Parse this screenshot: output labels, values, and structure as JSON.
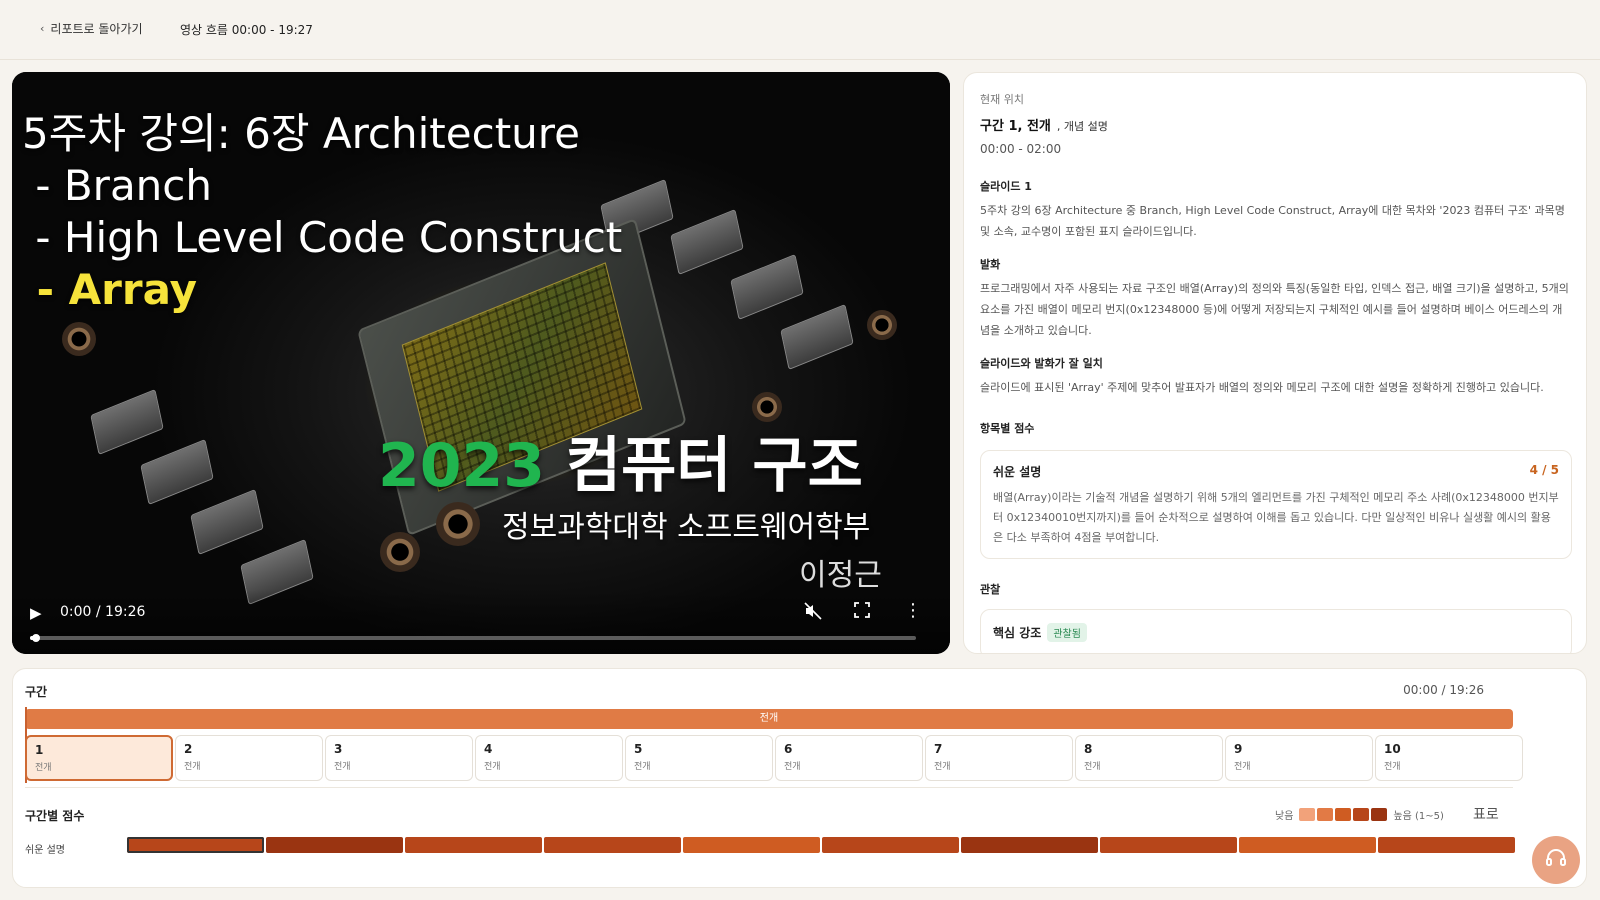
{
  "header": {
    "back_label": "리포트로 돌아가기",
    "flow_label": "영상 흐름 00:00 - 19:27"
  },
  "video": {
    "slide": {
      "title_line1": "5주차 강의: 6장 Architecture",
      "title_line2": " - Branch",
      "title_line3": " - High Level Code Construct",
      "title_line4": " - Array",
      "course_year": "2023",
      "course_name": " 컴퓨터 구조",
      "department": "정보과학대학 소프트웨어학부",
      "professor": "이정근"
    },
    "controls": {
      "time": "0:00 / 19:26",
      "progress_fraction": 0.004
    }
  },
  "panel": {
    "current_label": "현재 위치",
    "position": "구간 1, 전개",
    "position_sub": ", 개념 설명",
    "time_range": "00:00 - 02:00",
    "slide_heading": "슬라이드 1",
    "slide_text": "5주차 강의 6장 Architecture 중 Branch, High Level Code Construct, Array에 대한 목차와 '2023 컴퓨터 구조' 과목명 및 소속, 교수명이 포함된 표지 슬라이드입니다.",
    "speech_heading": "발화",
    "speech_text": "프로그래밍에서 자주 사용되는 자료 구조인 배열(Array)의 정의와 특징(동일한 타입, 인덱스 접근, 배열 크기)을 설명하고, 5개의 요소를 가진 배열이 메모리 번지(0x12348000 등)에 어떻게 저장되는지 구체적인 예시를 들어 설명하며 베이스 어드레스의 개념을 소개하고 있습니다.",
    "match_heading": "슬라이드와 발화가 잘 일치",
    "match_text": "슬라이드에 표시된 'Array' 주제에 맞추어 발표자가 배열의 정의와 메모리 구조에 대한 설명을 정확하게 진행하고 있습니다.",
    "scores_heading": "항목별 점수",
    "score_card": {
      "name": "쉬운 설명",
      "value": "4 / 5",
      "text": "배열(Array)이라는 기술적 개념을 설명하기 위해 5개의 엘리먼트를 가진 구체적인 메모리 주소 사례(0x12348000 번지부터 0x12340010번지까지)를 들어 순차적으로 설명하여 이해를 돕고 있습니다. 다만 일상적인 비유나 실생활 예시의 활용은 다소 부족하여 4점을 부여합니다."
    },
    "observation_heading": "관찰",
    "observation": {
      "name": "핵심 강조",
      "badge": "관찰됨"
    }
  },
  "timeline": {
    "title": "구간",
    "time": "00:00 / 19:26",
    "bar_label": "전개",
    "segments": [
      {
        "num": "1",
        "label": "전개"
      },
      {
        "num": "2",
        "label": "전개"
      },
      {
        "num": "3",
        "label": "전개"
      },
      {
        "num": "4",
        "label": "전개"
      },
      {
        "num": "5",
        "label": "전개"
      },
      {
        "num": "6",
        "label": "전개"
      },
      {
        "num": "7",
        "label": "전개"
      },
      {
        "num": "8",
        "label": "전개"
      },
      {
        "num": "9",
        "label": "전개"
      },
      {
        "num": "10",
        "label": "전개"
      }
    ],
    "active_segment": 0,
    "scores_title": "구간별 점수",
    "legend_low": "낮음",
    "legend_high": "높음 (1~5)",
    "legend_colors": [
      "#f2a27a",
      "#e27a45",
      "#cf5c22",
      "#b7461a",
      "#9a3411"
    ],
    "table_label": "표로",
    "score_rows": [
      {
        "name": "쉬운 설명",
        "scores": [
          4,
          5,
          4,
          4,
          3,
          4,
          5,
          4,
          3,
          4
        ]
      }
    ]
  },
  "icons": {
    "back": "chevron-left-icon",
    "play": "play-icon",
    "mute": "volume-muted-icon",
    "fullscreen": "fullscreen-icon",
    "more": "more-vertical-icon",
    "support": "headset-icon"
  }
}
